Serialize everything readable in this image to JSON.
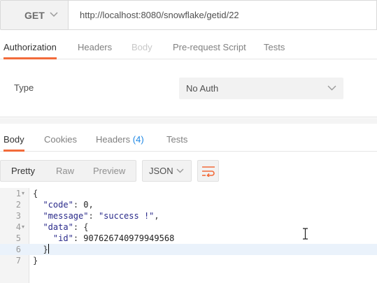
{
  "request": {
    "method": "GET",
    "url": "http://localhost:8080/snowflake/getid/22"
  },
  "request_tabs": [
    "Authorization",
    "Headers",
    "Body",
    "Pre-request Script",
    "Tests"
  ],
  "auth": {
    "type_label": "Type",
    "type_value": "No Auth"
  },
  "response_tabs": {
    "body": "Body",
    "cookies": "Cookies",
    "headers": "Headers",
    "headers_count": "(4)",
    "tests": "Tests"
  },
  "view_modes": [
    "Pretty",
    "Raw",
    "Preview"
  ],
  "format": "JSON",
  "code": {
    "line_numbers": [
      "1",
      "2",
      "3",
      "4",
      "5",
      "6",
      "7"
    ],
    "keys": {
      "code": "\"code\"",
      "message": "\"message\"",
      "data": "\"data\"",
      "id": "\"id\""
    },
    "values": {
      "code": "0",
      "message": "\"success !\"",
      "id": "907626740979949568"
    }
  },
  "colors": {
    "accent": "#f26b3a",
    "count": "#1e88e5",
    "active_line": "#eaf2fb"
  },
  "icons": [
    "chevron-down-icon",
    "wrap-lines-icon",
    "text-cursor-icon"
  ]
}
